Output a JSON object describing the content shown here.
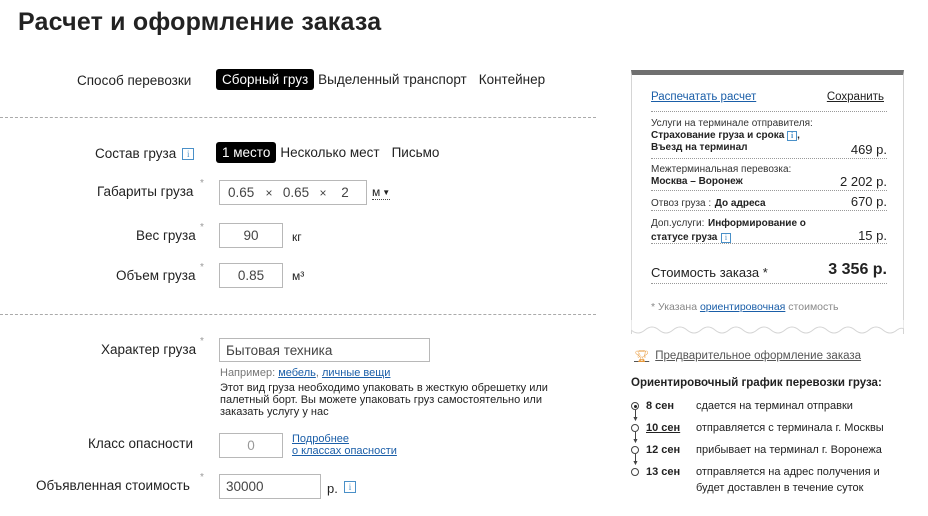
{
  "page_title": "Расчет и оформление заказа",
  "transport": {
    "label": "Способ перевозки",
    "options": [
      "Сборный груз",
      "Выделенный транспорт",
      "Контейнер"
    ],
    "selected": "Сборный груз"
  },
  "composition": {
    "label": "Состав груза",
    "info_icon": "i",
    "options": [
      "1 место",
      "Несколько мест",
      "Письмо"
    ],
    "selected": "1 место"
  },
  "dimensions": {
    "label": "Габариты груза",
    "required_mark": "*",
    "length": "0.65",
    "width": "0.65",
    "height": "2",
    "separator": "×",
    "unit": "м"
  },
  "weight": {
    "label": "Вес груза",
    "required_mark": "*",
    "value": "90",
    "unit": "кг"
  },
  "volume": {
    "label": "Объем груза",
    "required_mark": "*",
    "value": "0.85",
    "unit": "м³"
  },
  "cargo_type": {
    "label": "Характер груза",
    "required_mark": "*",
    "value": "Бытовая техника",
    "hint_prefix": "Например:",
    "hint_link1": "мебель",
    "hint_sep": ",",
    "hint_link2": "личные вещи",
    "note": "Этот вид груза необходимо упаковать в жесткую обрешетку или палетный борт. Вы можете упаковать груз самостоятельно или заказать услугу у нас"
  },
  "hazard": {
    "label": "Класс опасности",
    "value": "0",
    "link_line1": "Подробнее",
    "link_line2": "о классах опасности"
  },
  "declared_value": {
    "label": "Объявленная стоимость",
    "required_mark": "*",
    "value": "30000",
    "unit": "р.",
    "info_icon": "i"
  },
  "receipt": {
    "print_label": "Распечатать расчет",
    "save_label": "Сохранить",
    "sender_services": {
      "title": "Услуги на терминале отправителя:",
      "line1": "Страхование груза и срока",
      "line1_suffix": ",",
      "line2": "Въезд на терминал",
      "price": "469 р."
    },
    "interterminal": {
      "title": "Межтерминальная перевозка:",
      "route": "Москва – Воронеж",
      "price": "2 202 р."
    },
    "delivery": {
      "title": "Отвоз груза :",
      "value": "До адреса",
      "price": "670 р."
    },
    "extra": {
      "title": "Доп.услуги:",
      "value1": "Информирование о",
      "value2": "статусе груза",
      "price": "15 р."
    },
    "total_label": "Стоимость заказа *",
    "total": "3 356 р.",
    "footnote_prefix": "* Указана",
    "footnote_link": "ориентировочная",
    "footnote_suffix": "стоимость"
  },
  "pre_order_link": "Предварительное оформление заказа",
  "schedule": {
    "title": "Ориентировочный график перевозки груза:",
    "items": [
      {
        "date": "8 сен",
        "desc": "сдается на терминал отправки"
      },
      {
        "date": "10 сен",
        "desc": "отправляется с терминала г. Москвы"
      },
      {
        "date": "12 сен",
        "desc": "прибывает на терминал г. Воронежа"
      },
      {
        "date": "13 сен",
        "desc": "отправляется на адрес получения и будет доставлен в течение суток"
      }
    ]
  },
  "colors": {
    "link": "#1a5ea8",
    "active_bg": "#000000",
    "receipt_top": "#707070",
    "trophy": "#e89a3c"
  }
}
